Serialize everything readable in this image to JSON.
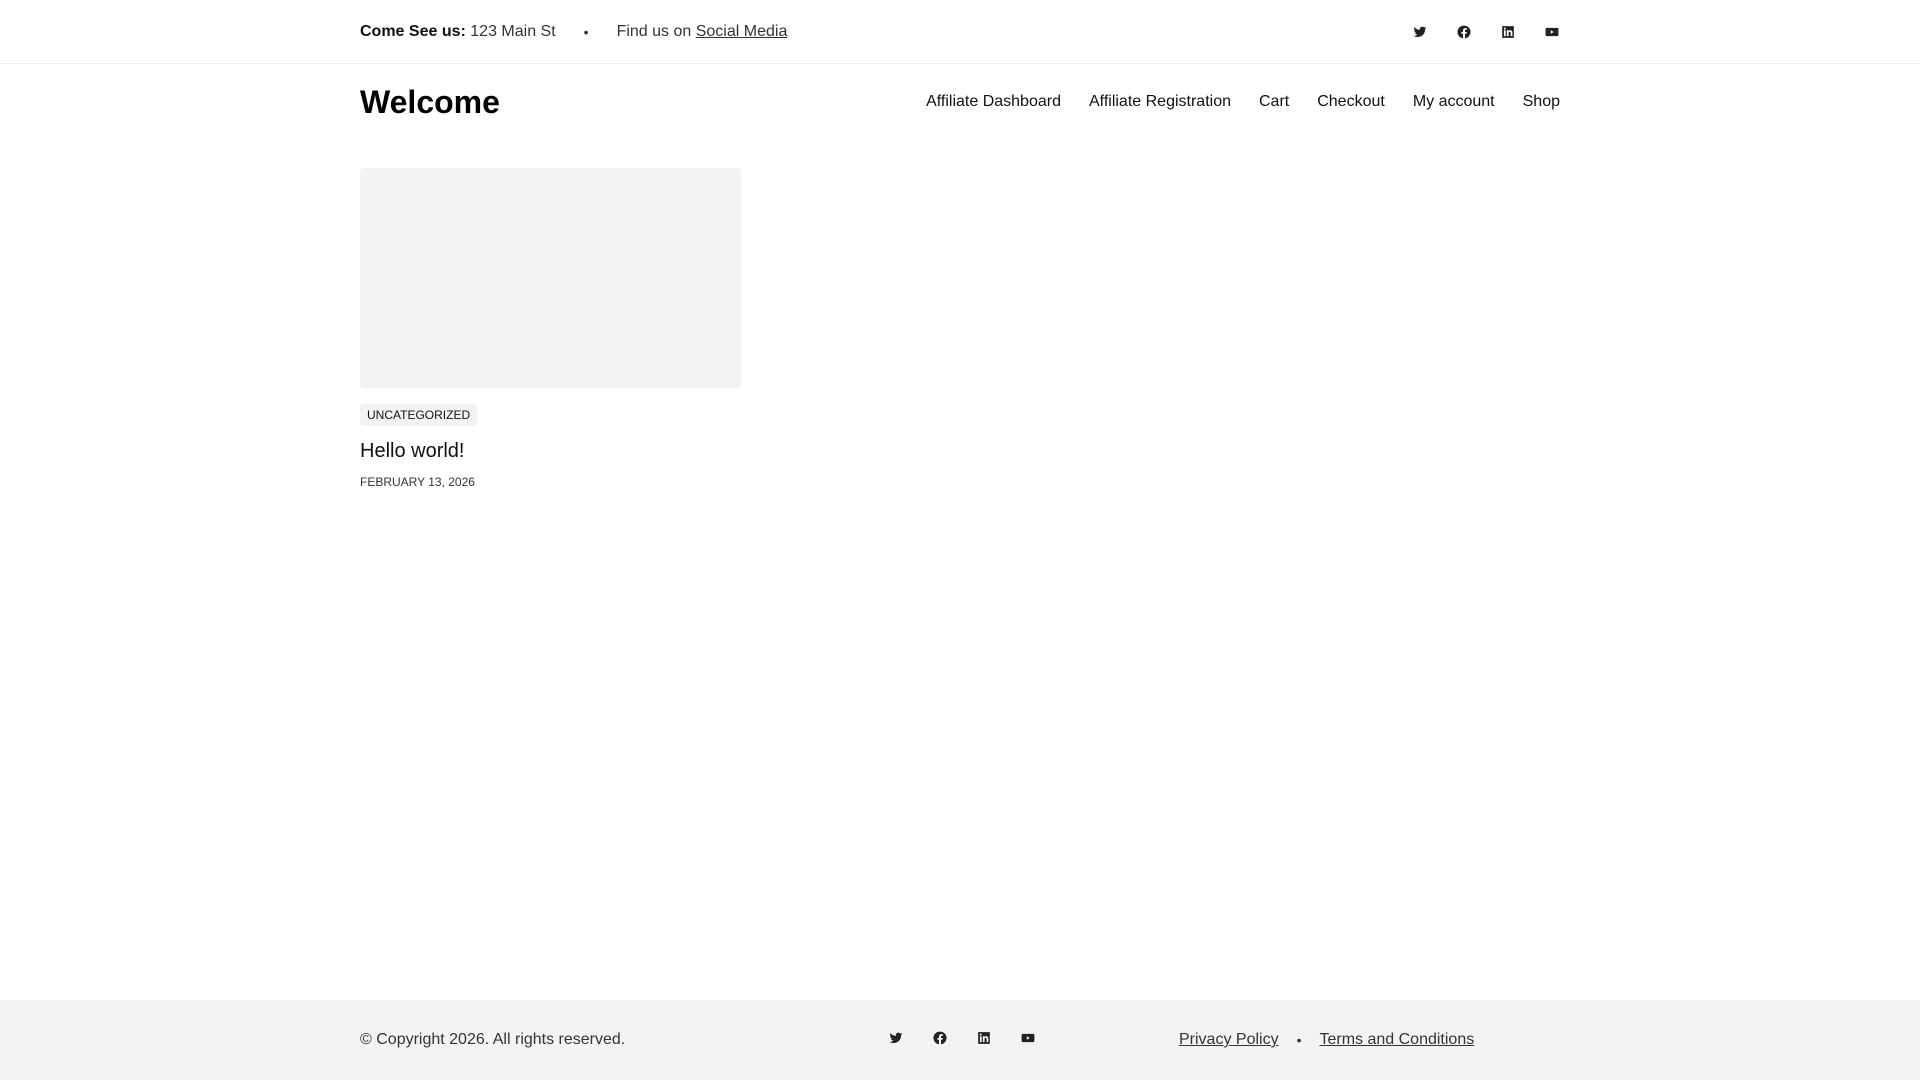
{
  "topbar": {
    "visit_label": "Come See us:",
    "address": "123 Main St",
    "separator": "•",
    "find_text": "Find us on",
    "social_link": "Social Media",
    "icons": [
      "twitter-icon",
      "facebook-icon",
      "linkedin-icon",
      "youtube-icon"
    ]
  },
  "header": {
    "site_title": "Welcome",
    "nav": [
      "Affiliate Dashboard",
      "Affiliate Registration",
      "Cart",
      "Checkout",
      "My account",
      "Shop"
    ]
  },
  "post": {
    "category": "UNCATEGORIZED",
    "title": "Hello world!",
    "date": "FEBRUARY 13, 2026"
  },
  "footer": {
    "copyright": "© Copyright 2026. All rights reserved.",
    "links": [
      "Privacy Policy",
      "Terms and Conditions"
    ],
    "separator": "•"
  }
}
